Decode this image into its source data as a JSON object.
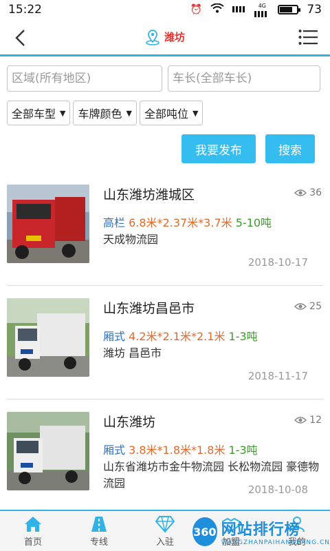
{
  "status_bar": {
    "time": "15:22",
    "signal_label": "4G",
    "battery_level": "73",
    "battery_fraction": 0.73
  },
  "nav": {
    "title": "潍坊"
  },
  "filters": {
    "area_placeholder": "区域(所有地区)",
    "length_placeholder": "车长(全部车长)",
    "vehicle_type": "全部车型",
    "plate_color": "车牌颜色",
    "tonnage": "全部吨位"
  },
  "actions": {
    "publish_label": "我要发布",
    "search_label": "搜索"
  },
  "listings": [
    {
      "title": "山东潍坊潍城区",
      "views": "36",
      "type": "高栏",
      "dimensions": "6.8米*2.37米*3.7米",
      "tonnage": "5-10吨",
      "location": "天成物流园",
      "date": "2018-10-17",
      "truck_color": "#c8262a"
    },
    {
      "title": "山东潍坊昌邑市",
      "views": "25",
      "type": "厢式",
      "dimensions": "4.2米*2.1米*2.1米",
      "tonnage": "1-3吨",
      "location": "潍坊 昌邑市",
      "date": "2018-11-17",
      "truck_color": "#eaeaea"
    },
    {
      "title": "山东潍坊",
      "views": "12",
      "type": "厢式",
      "dimensions": "3.8米*1.8米*1.8米",
      "tonnage": "1-3吨",
      "location": "山东省潍坊市金牛物流园 长松物流园 豪德物流园",
      "date": "2018-10-08",
      "truck_color": "#e4e4e4"
    }
  ],
  "tabs": [
    {
      "label": "首页",
      "icon": "home-icon"
    },
    {
      "label": "专线",
      "icon": "road-icon"
    },
    {
      "label": "入驻",
      "icon": "diamond-icon"
    },
    {
      "label": "加盟",
      "icon": "handshake-icon"
    },
    {
      "label": "我的",
      "icon": "user-icon"
    }
  ],
  "watermark": {
    "badge": "360",
    "main": "网站排行榜",
    "sub": "WANGZHANPAIHANGBANG.CN"
  },
  "colors": {
    "accent": "#36bdef",
    "title_red": "#e5322d",
    "type_blue": "#2f6fbf",
    "dimension_orange": "#e06a2c",
    "tonnage_green": "#3f9a2d"
  }
}
